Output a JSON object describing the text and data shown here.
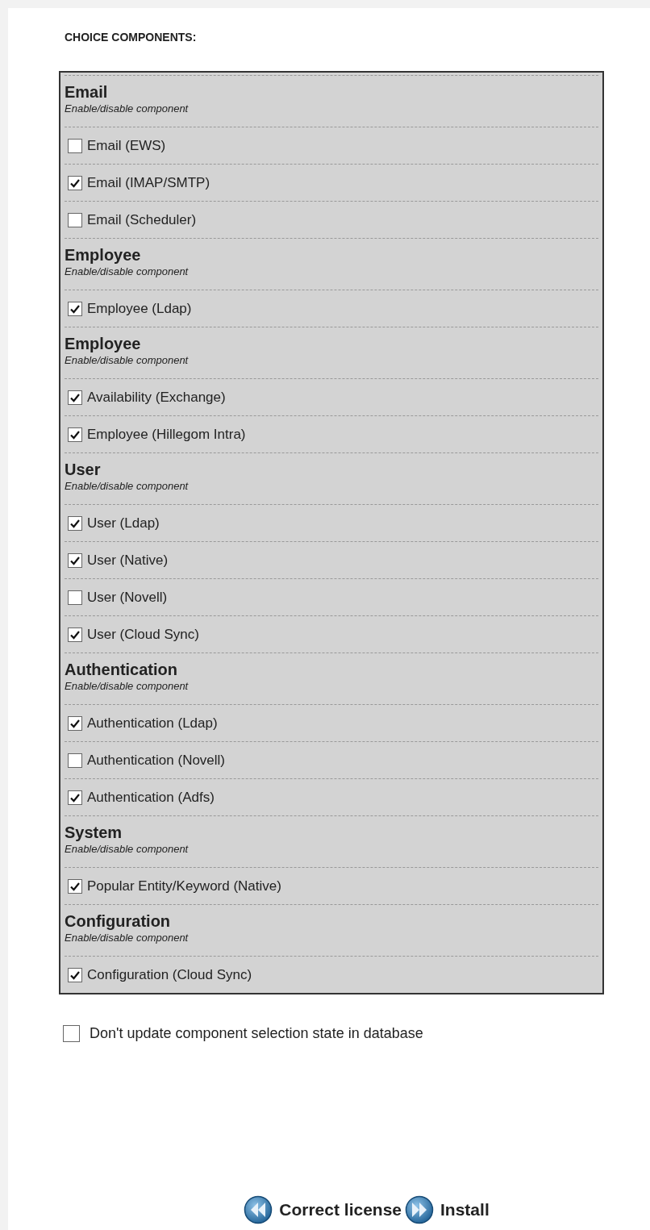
{
  "heading": "CHOICE COMPONENTS:",
  "groups": [
    {
      "title": "Email",
      "subtitle": "Enable/disable component",
      "items": [
        {
          "label": "Email (EWS)",
          "checked": false
        },
        {
          "label": "Email (IMAP/SMTP)",
          "checked": true
        },
        {
          "label": "Email (Scheduler)",
          "checked": false
        }
      ]
    },
    {
      "title": "Employee",
      "subtitle": "Enable/disable component",
      "items": [
        {
          "label": "Employee (Ldap)",
          "checked": true
        }
      ]
    },
    {
      "title": "Employee",
      "subtitle": "Enable/disable component",
      "items": [
        {
          "label": "Availability (Exchange)",
          "checked": true
        },
        {
          "label": "Employee (Hillegom Intra)",
          "checked": true
        }
      ]
    },
    {
      "title": "User",
      "subtitle": "Enable/disable component",
      "items": [
        {
          "label": "User (Ldap)",
          "checked": true
        },
        {
          "label": "User (Native)",
          "checked": true
        },
        {
          "label": "User (Novell)",
          "checked": false
        },
        {
          "label": "User (Cloud Sync)",
          "checked": true
        }
      ]
    },
    {
      "title": "Authentication",
      "subtitle": "Enable/disable component",
      "items": [
        {
          "label": "Authentication (Ldap)",
          "checked": true
        },
        {
          "label": "Authentication (Novell)",
          "checked": false
        },
        {
          "label": "Authentication (Adfs)",
          "checked": true
        }
      ]
    },
    {
      "title": "System",
      "subtitle": "Enable/disable component",
      "items": [
        {
          "label": "Popular Entity/Keyword (Native)",
          "checked": true
        }
      ]
    },
    {
      "title": "Configuration",
      "subtitle": "Enable/disable component",
      "items": [
        {
          "label": "Configuration (Cloud Sync)",
          "checked": true
        }
      ]
    }
  ],
  "no_update": {
    "label": "Don't update component selection state in database",
    "checked": false
  },
  "buttons": [
    {
      "label": "Correct license",
      "kind": "back"
    },
    {
      "label": "Install",
      "kind": "forward"
    }
  ]
}
